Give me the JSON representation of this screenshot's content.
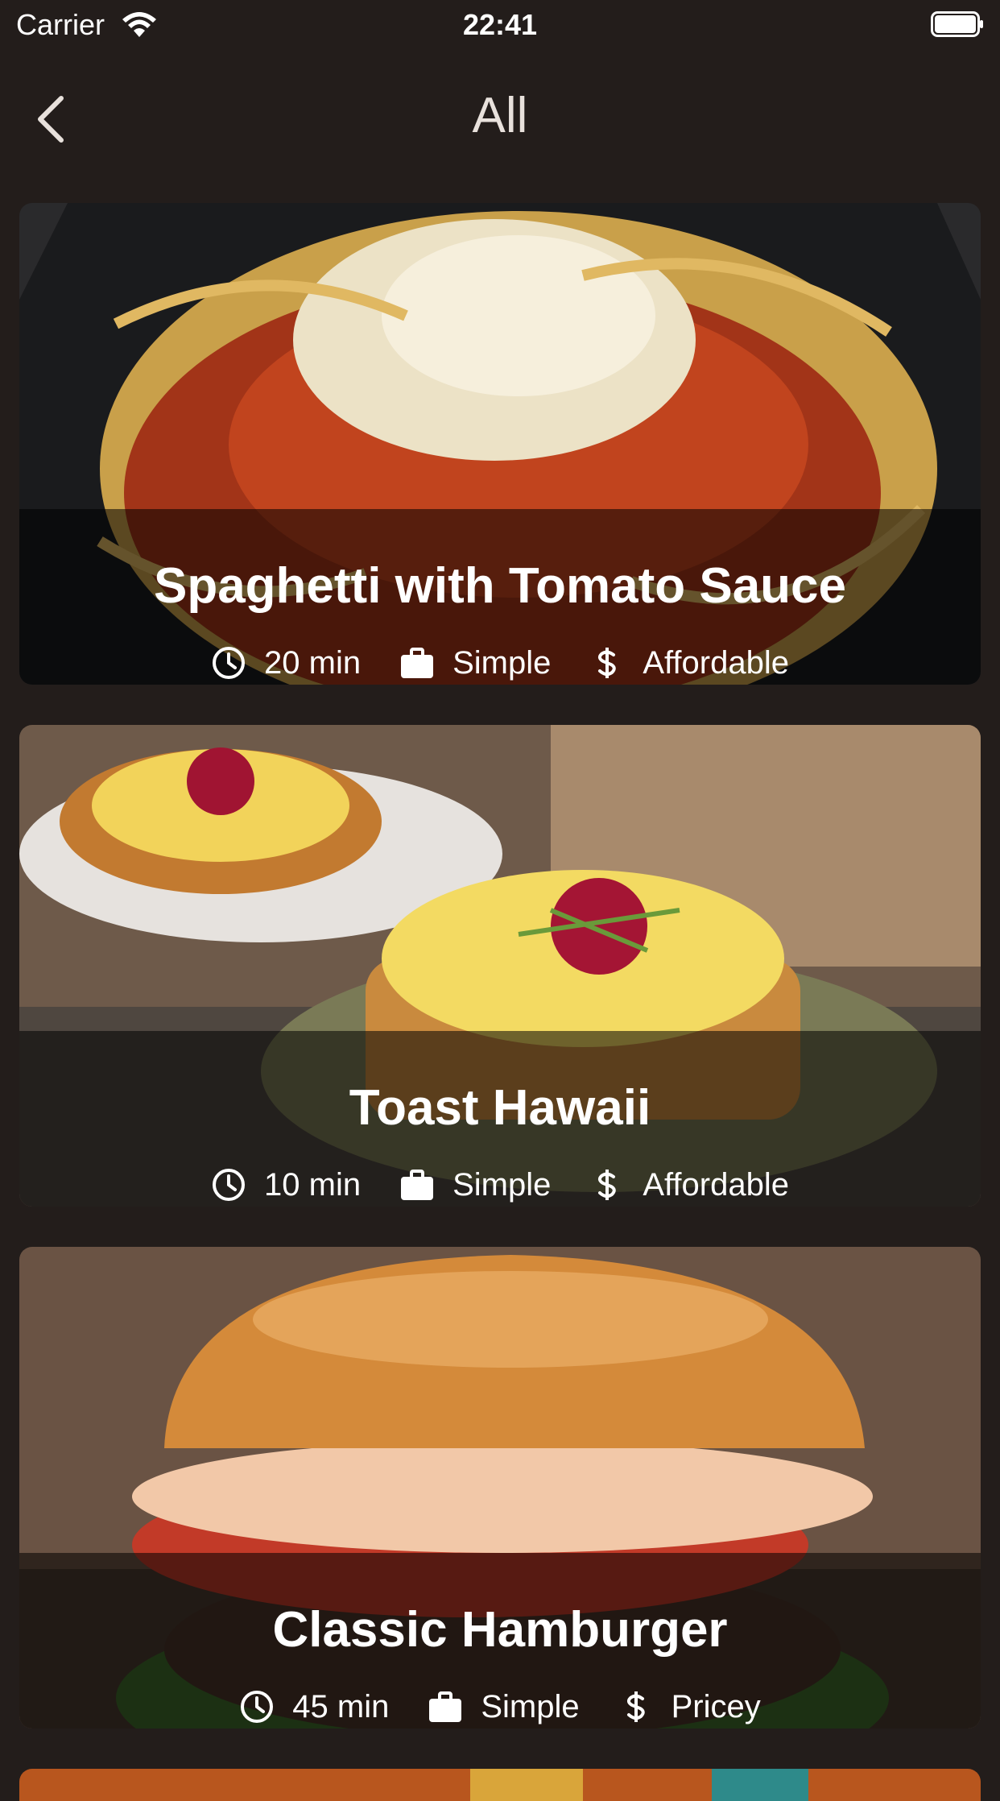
{
  "status_bar": {
    "carrier": "Carrier",
    "time": "22:41"
  },
  "nav": {
    "title": "All",
    "back_icon": "chevron-left-icon"
  },
  "meals": [
    {
      "title": "Spaghetti with Tomato Sauce",
      "duration": "20 min",
      "complexity": "Simple",
      "affordability": "Affordable"
    },
    {
      "title": "Toast Hawaii",
      "duration": "10 min",
      "complexity": "Simple",
      "affordability": "Affordable"
    },
    {
      "title": "Classic Hamburger",
      "duration": "45 min",
      "complexity": "Simple",
      "affordability": "Pricey"
    }
  ],
  "icons": {
    "duration": "clock-icon",
    "complexity": "briefcase-icon",
    "affordability": "dollar-icon"
  },
  "colors": {
    "background": "#231d1b",
    "text": "#ffffff",
    "overlay": "rgba(0,0,0,0.55)"
  }
}
